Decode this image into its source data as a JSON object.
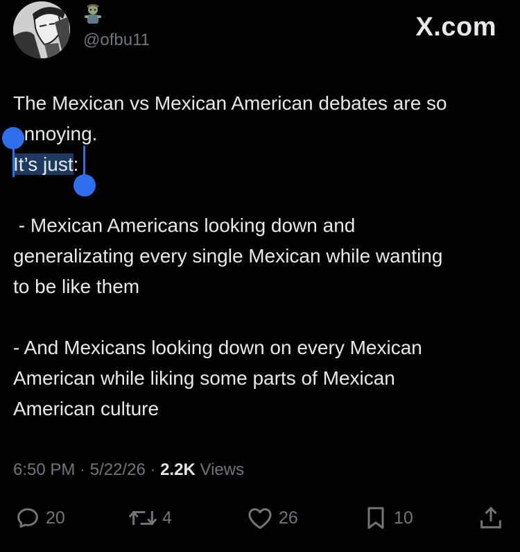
{
  "author": {
    "handle": "@ofbu11",
    "avatar_icon": "anime-character-avatar",
    "badge_icon": "zombie-emoji-icon"
  },
  "brand": {
    "label": "X.com"
  },
  "tweet": {
    "lines": [
      "The Mexican vs Mexican American debates are so",
      "annoying.",
      "It’s just:",
      "",
      " - Mexican Americans looking down and",
      "generalizating every single Mexican while wanting",
      "to be like them",
      "",
      "- And Mexicans looking down on every Mexican",
      "American while liking some parts of Mexican",
      "American culture"
    ],
    "selection": {
      "text": "It’s just",
      "color": "#2f6fed"
    }
  },
  "meta": {
    "time": "6:50 PM",
    "sep1": " · ",
    "date": "5/22/26",
    "sep2": " · ",
    "views_count": "2.2K",
    "views_label": " Views"
  },
  "actions": {
    "replies": "20",
    "reposts": "4",
    "likes": "26",
    "bookmarks": "10"
  },
  "colors": {
    "background": "#000000",
    "text": "#e7e9ea",
    "secondary": "#71767b",
    "selection_handle": "#2f6fed"
  }
}
